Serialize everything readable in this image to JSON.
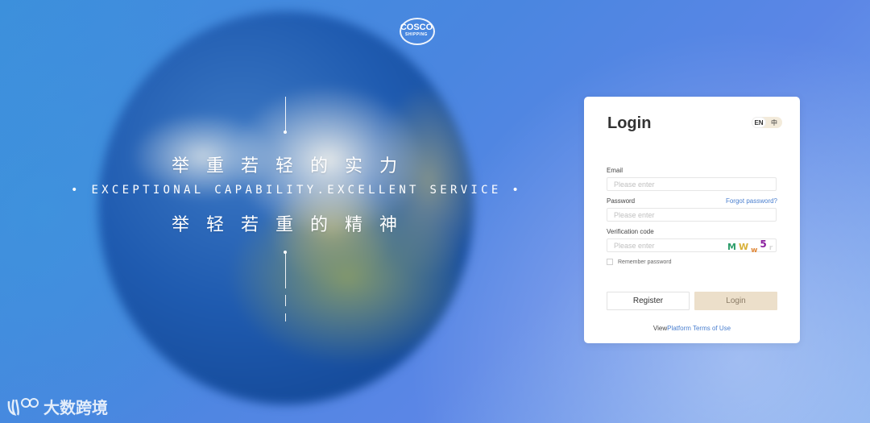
{
  "branding": {
    "logo_line1": "COSCO",
    "logo_line2": "SHIPPING"
  },
  "hero": {
    "slogan_cn_1": "举重若轻的实力",
    "slogan_en": "• EXCEPTIONAL CAPABILITY.EXCELLENT SERVICE •",
    "slogan_cn_2": "举轻若重的精神"
  },
  "login": {
    "title": "Login",
    "lang_en": "EN",
    "lang_zh": "中",
    "email_label": "Email",
    "email_placeholder": "Please enter",
    "password_label": "Password",
    "password_placeholder": "Please enter",
    "forgot_password": "Forgot password?",
    "verification_label": "Verification code",
    "verification_placeholder": "Please enter",
    "captcha": [
      "M",
      "W",
      "w",
      "5",
      "r"
    ],
    "captcha_colors": [
      "#2e9e6b",
      "#d9b13a",
      "#e0893a",
      "#8a1e9e",
      "#d8d8d8"
    ],
    "remember_password": "Remember password",
    "register_button": "Register",
    "login_button": "Login",
    "terms_prefix": "View",
    "terms_link": "Platform Terms of Use"
  },
  "watermark": {
    "text": "大数跨境"
  }
}
